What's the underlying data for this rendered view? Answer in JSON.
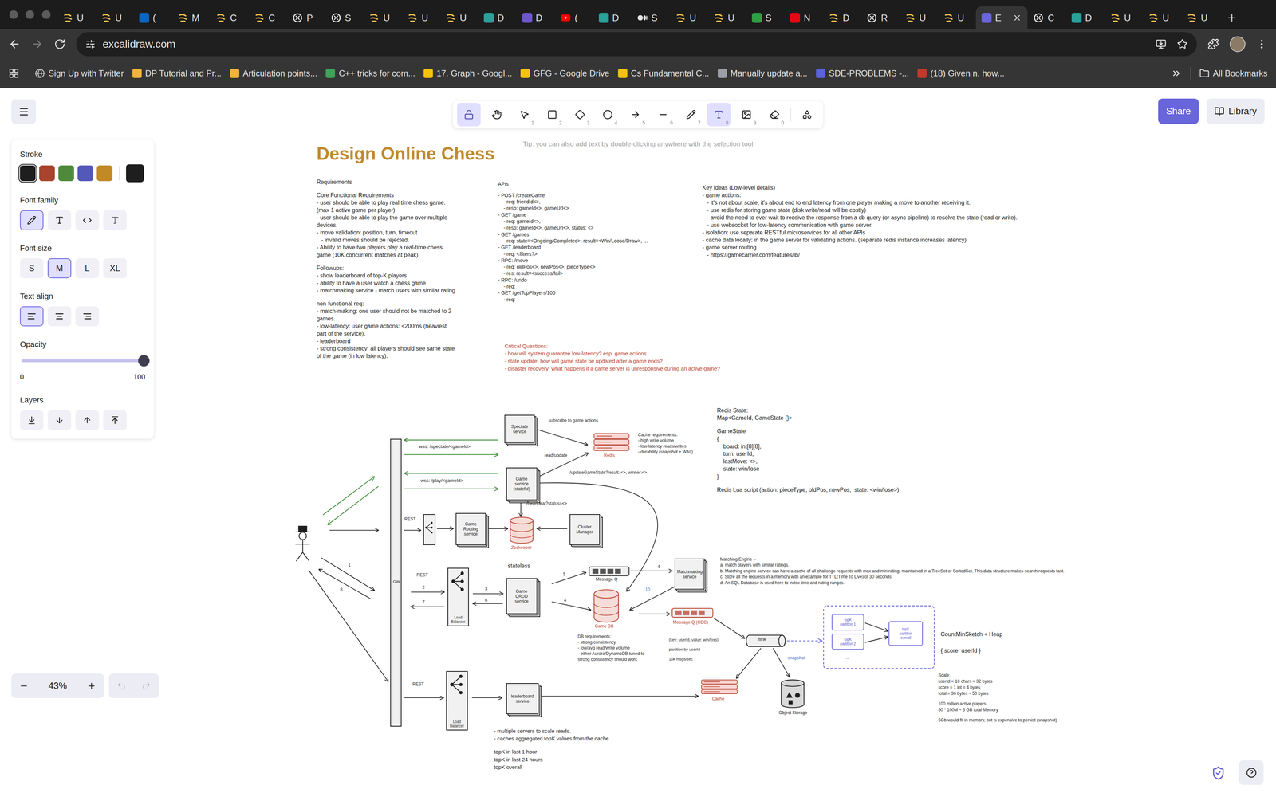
{
  "browser": {
    "tabs": [
      {
        "title": "U",
        "kind": "feather",
        "selected": false
      },
      {
        "title": "U",
        "kind": "feather",
        "selected": false
      },
      {
        "title": "(",
        "kind": "linkedin",
        "selected": false
      },
      {
        "title": "M",
        "kind": "feather",
        "selected": false
      },
      {
        "title": "C",
        "kind": "feather",
        "selected": false
      },
      {
        "title": "C",
        "kind": "feather",
        "selected": false
      },
      {
        "title": "P",
        "kind": "openai",
        "selected": false
      },
      {
        "title": "S",
        "kind": "openai",
        "selected": false
      },
      {
        "title": "U",
        "kind": "feather",
        "selected": false
      },
      {
        "title": "U",
        "kind": "feather",
        "selected": false
      },
      {
        "title": "U",
        "kind": "feather",
        "selected": false
      },
      {
        "title": "D",
        "kind": "perplexity",
        "selected": false
      },
      {
        "title": "D",
        "kind": "purple",
        "selected": false
      },
      {
        "title": "(",
        "kind": "youtube",
        "selected": false
      },
      {
        "title": "D",
        "kind": "perplexity",
        "selected": false
      },
      {
        "title": "S",
        "kind": "medium",
        "selected": false
      },
      {
        "title": "U",
        "kind": "feather",
        "selected": false
      },
      {
        "title": "U",
        "kind": "feather",
        "selected": false
      },
      {
        "title": "S",
        "kind": "wiki",
        "selected": false
      },
      {
        "title": "N",
        "kind": "netflix",
        "selected": false
      },
      {
        "title": "D",
        "kind": "feather",
        "selected": false
      },
      {
        "title": "R",
        "kind": "openai",
        "selected": false
      },
      {
        "title": "U",
        "kind": "feather",
        "selected": false
      },
      {
        "title": "U",
        "kind": "feather",
        "selected": false
      },
      {
        "title": "E",
        "kind": "excalidraw",
        "selected": true
      },
      {
        "title": "C",
        "kind": "openai",
        "selected": false
      },
      {
        "title": "D",
        "kind": "perplexity",
        "selected": false
      },
      {
        "title": "U",
        "kind": "feather",
        "selected": false
      },
      {
        "title": "U",
        "kind": "feather",
        "selected": false
      },
      {
        "title": "U",
        "kind": "feather",
        "selected": false
      }
    ],
    "address": "excalidraw.com",
    "bookmarks": [
      {
        "label": "Sign Up with Twitter",
        "kind": "globe"
      },
      {
        "label": "DP Tutorial and Pr...",
        "kind": "chart"
      },
      {
        "label": "Articulation points...",
        "kind": "chart"
      },
      {
        "label": "C++ tricks for com...",
        "kind": "link"
      },
      {
        "label": "17. Graph - Googl...",
        "kind": "drive"
      },
      {
        "label": "GFG - Google Drive",
        "kind": "drive"
      },
      {
        "label": "Cs Fundamental C...",
        "kind": "drive"
      },
      {
        "label": "Manually update a...",
        "kind": "reddit"
      },
      {
        "label": "SDE-PROBLEMS -...",
        "kind": "docs"
      },
      {
        "label": "(18) Given n, how...",
        "kind": "quora"
      }
    ],
    "all_bookmarks": "All Bookmarks"
  },
  "toolbar": {
    "tools": [
      {
        "kind": "lock",
        "shortcut": "",
        "selected": true
      },
      {
        "kind": "hand",
        "shortcut": "",
        "selected": false
      },
      {
        "kind": "selection",
        "shortcut": "1",
        "selected": false
      },
      {
        "kind": "rectangle",
        "shortcut": "2",
        "selected": false
      },
      {
        "kind": "diamond",
        "shortcut": "3",
        "selected": false
      },
      {
        "kind": "ellipse",
        "shortcut": "4",
        "selected": false
      },
      {
        "kind": "arrow",
        "shortcut": "5",
        "selected": false
      },
      {
        "kind": "line",
        "shortcut": "6",
        "selected": false
      },
      {
        "kind": "freedraw",
        "shortcut": "7",
        "selected": false
      },
      {
        "kind": "text",
        "shortcut": "8",
        "selected": true
      },
      {
        "kind": "image",
        "shortcut": "9",
        "selected": false
      },
      {
        "kind": "eraser",
        "shortcut": "0",
        "selected": false
      },
      {
        "kind": "extra",
        "shortcut": "",
        "selected": false
      }
    ],
    "hint": "Tip: you can also add text by double-clicking anywhere with the selection tool",
    "share": "Share",
    "library": "Library"
  },
  "properties": {
    "stroke": {
      "label": "Stroke",
      "colors": [
        {
          "color": "#1e1e1e",
          "selected": true
        },
        {
          "color": "#a8442d",
          "selected": false
        },
        {
          "color": "#4f8a3c",
          "selected": false
        },
        {
          "color": "#5458b8",
          "selected": false
        },
        {
          "color": "#c28a25",
          "selected": false
        }
      ],
      "current": "#1e1e1e"
    },
    "font_family": {
      "label": "Font family",
      "options": [
        {
          "kind": "hand",
          "selected": true
        },
        {
          "kind": "normal",
          "selected": false
        },
        {
          "kind": "code",
          "selected": false
        },
        {
          "kind": "outline",
          "selected": false
        }
      ]
    },
    "font_size": {
      "label": "Font size",
      "options": [
        {
          "label": "S",
          "selected": false
        },
        {
          "label": "M",
          "selected": true
        },
        {
          "label": "L",
          "selected": false
        },
        {
          "label": "XL",
          "selected": false
        }
      ]
    },
    "text_align": {
      "label": "Text align",
      "options": [
        {
          "kind": "left",
          "selected": true
        },
        {
          "kind": "center",
          "selected": false
        },
        {
          "kind": "right",
          "selected": false
        }
      ]
    },
    "opacity": {
      "label": "Opacity",
      "level": 1,
      "min": "0",
      "max": "100"
    },
    "layers": {
      "label": "Layers",
      "actions": [
        {
          "kind": "to-back"
        },
        {
          "kind": "backward"
        },
        {
          "kind": "forward"
        },
        {
          "kind": "to-front"
        }
      ]
    }
  },
  "zoom": {
    "level": "43%",
    "undo_disabled": true,
    "redo_disabled": true
  },
  "canvas": {
    "title": "Design Online Chess",
    "notes": [
      {
        "color": "#1e1e1e",
        "lines": [
          "Requirements",
          "",
          "Core Functional Requirements",
          "- user should be able to play real time chess game.",
          "(max 1 active game per player)",
          "- user should be able to play the game over multiple",
          "devices.",
          "- move validation: position, turn, timeout",
          "   - invalid moves should be rejected.",
          "- Ability to have two players play a real-time chess",
          "game (10K concurrent matches at peak)",
          "",
          "Followups:",
          "- show leaderboard of top-K players",
          "- ability to have a user watch a chess game",
          "- matchmaking service - match users with similar rating",
          "",
          "non-functional req:",
          "- match-making: one user should not be matched to 2",
          "games.",
          "- low-latency: user game actions: <200ms (heaviest",
          "part of the service).",
          "- leaderboard",
          "- strong consistency: all players should see same state",
          "of the game (in low latency)."
        ]
      },
      {
        "color": "#1e1e1e",
        "lines": [
          "APIs",
          "",
          "- POST /createGame",
          "    - req: friendId<>,",
          "    - resp: gameId<>, gameUrl<>",
          "- GET /game",
          "    - req: gameId<>,",
          "    - resp: gameId<>, gameUrl<>, status: <>",
          "- GET /games",
          "    - req: state=<Ongoing/Completed>, result=<Win/Loose/Draw>, ...",
          "- GET /leaderboard",
          "    - req: <filters?>",
          "- RPC: /move",
          "    - req: oldPos<>, newPos<>, pieceType<>",
          "    - res: result=<success/fail>",
          "- RPC: /undo",
          "    - req:",
          "- GET /getTopPlayers/100",
          "    - req:"
        ]
      },
      {
        "color": "#1e1e1e",
        "lines": [
          "Key Ideas (Low-level details)",
          "- game actions:",
          "   - it's not about scale, it's about end to end latency from one player making a move to another receiving it.",
          "   - use redis for storing game state (disk write/read will be costly)",
          "   - avoid the need to ever wait to receive the response from a db query (or async pipeline) to resolve the state (read or write).",
          "   - use websocket for low-latency communication with game server.",
          "- isolation: use separate RESTful microservices for all other APIs",
          "- cache data locally: in the game server for validating actions. (separate redis instance increases latency)",
          "- game server routing",
          "   - https://gamecarrier.com/features/lb/"
        ]
      },
      {
        "color": "#b8402d",
        "lines": [
          "Critical Questions:",
          "- how will system guarantee low-latency? esp. game actions",
          "- state update: how will game state be updated after a game ends?",
          "- disaster recovery: what happens if a game server is unresponsive during an active game?"
        ]
      },
      {
        "color": "#1e1e1e",
        "lines": [
          "Redis State:",
          "Map<GameId, GameState {}>",
          "",
          "GameState",
          "{",
          "    board: int[8][8],",
          "    turn: userId,",
          "    lastMove: <>,",
          "    state: win/lose",
          "}",
          "",
          "Redis Lua script (action: pieceType, oldPos, newPos,  state: <win/lose>)"
        ]
      },
      {
        "color": "#1e1e1e",
        "lines": [
          "Cache requirements:",
          "- high write volume",
          "- low-latency reads/writes",
          "- durability (snapshot + WAL)"
        ]
      },
      {
        "color": "#1e1e1e",
        "lines": [
          "DB requirements:",
          "- strong consistency",
          "- low/avg read/write volume",
          "- either Aurora/DynamoDB tuned to",
          "strong consistency should work"
        ]
      },
      {
        "color": "#1e1e1e",
        "lines": [
          "(key: userId, value: win/loss)",
          "partition by userId",
          "10k msgs/sec"
        ]
      },
      {
        "color": "#1e1e1e",
        "lines": [
          "Matching Engine --",
          "a. match players with similar ratings.",
          "b. Matching engine service can have a cache of all challenge requests with max and min rating, maintained in a TreeSet or SortedSet. This data structure makes search requests fast.",
          "c. Store all the requests in a memory with an example for TTL(Time To Live) of 30 seconds.",
          "d. An SQL Database is used here to index time and rating ranges."
        ]
      },
      {
        "color": "#1e1e1e",
        "lines": [
          "CountMinSketch + Heap",
          "{ score: userId }"
        ]
      },
      {
        "color": "#1e1e1e",
        "lines": [
          "Scale:",
          "userId = 16 chars = 32 bytes",
          "score = 1 int = 4 bytes",
          "total = 36 bytes ~ 50 bytes",
          "",
          "100 million active players",
          "50 * 100M ~ 5 GB total Memory",
          "",
          "5Gb would fit in memory, but is expensive to persist (snapshot)"
        ]
      },
      {
        "color": "#1e1e1e",
        "lines": [
          "- multiple servers to scale reads.",
          "- caches aggregated topK values from the cache",
          "",
          "topK in last 1 hour",
          "topK in last 24 hours",
          "topK overall"
        ]
      }
    ],
    "nodes": [
      {
        "lines": [
          "Spectate",
          "service"
        ]
      },
      {
        "lines": [
          "Game",
          "service",
          "(stateful)"
        ]
      },
      {
        "lines": [
          "Game",
          "Routing",
          "service"
        ]
      },
      {
        "lines": [
          "Cluster",
          "Manager"
        ]
      },
      {
        "lines": [
          "Game",
          "CRUD",
          "service"
        ]
      },
      {
        "lines": [
          "Matchmaking",
          "service"
        ]
      },
      {
        "lines": [
          "leaderboard",
          "service"
        ]
      }
    ],
    "load_balancers": [
      {
        "lines": []
      },
      {
        "lines": [
          "Load",
          "Balancer"
        ]
      },
      {
        "lines": [
          "Load",
          "Balancer"
        ]
      }
    ],
    "labels": [
      {
        "text": "GW",
        "color": "#1e1e1e"
      },
      {
        "text": "wss: /spectate/<gameId>",
        "color": "#1e1e1e"
      },
      {
        "text": "wss: /play/<gameId>",
        "color": "#1e1e1e"
      },
      {
        "text": "subscribe to game actions",
        "color": "#1e1e1e"
      },
      {
        "text": "read/update",
        "color": "#1e1e1e"
      },
      {
        "text": "/updateGameState?result: <>, winner:<>",
        "color": "#1e1e1e"
      },
      {
        "text": "/heartbeat?status=<>",
        "color": "#1e1e1e"
      },
      {
        "text": "REST",
        "color": "#1e1e1e"
      },
      {
        "text": "REST",
        "color": "#1e1e1e"
      },
      {
        "text": "REST",
        "color": "#1e1e1e"
      },
      {
        "text": "stateless",
        "color": "#1e1e1e"
      },
      {
        "text": "Redis",
        "color": "#b8402d"
      },
      {
        "text": "Zookeeper",
        "color": "#b8402d"
      },
      {
        "text": "Message Q",
        "color": "#1e1e1e"
      },
      {
        "text": "Game DB",
        "color": "#b8402d"
      },
      {
        "text": "Message Q (CDC)",
        "color": "#b8402d"
      },
      {
        "text": "flink",
        "color": "#1e1e1e"
      },
      {
        "text": "Cache",
        "color": "#b8402d"
      },
      {
        "text": "Object Storage",
        "color": "#1e1e1e"
      },
      {
        "text": "snapshot",
        "color": "#4a6fc5"
      },
      {
        "text": "1",
        "color": "#1e1e1e"
      },
      {
        "text": "8",
        "color": "#1e1e1e"
      },
      {
        "text": "2",
        "color": "#1e1e1e"
      },
      {
        "text": "7",
        "color": "#1e1e1e"
      },
      {
        "text": "3",
        "color": "#1e1e1e"
      },
      {
        "text": "6",
        "color": "#1e1e1e"
      },
      {
        "text": "5",
        "color": "#1e1e1e"
      },
      {
        "text": "4",
        "color": "#1e1e1e"
      },
      {
        "text": "4",
        "color": "#1e1e1e"
      },
      {
        "text": "10",
        "color": "#4a6fc5"
      }
    ],
    "topk": {
      "partitions": [
        [
          "topK",
          "partition 1"
        ],
        [
          "topK",
          "partition 2"
        ]
      ],
      "more": "...",
      "overall": [
        "topK",
        "partition",
        "overall"
      ]
    }
  }
}
